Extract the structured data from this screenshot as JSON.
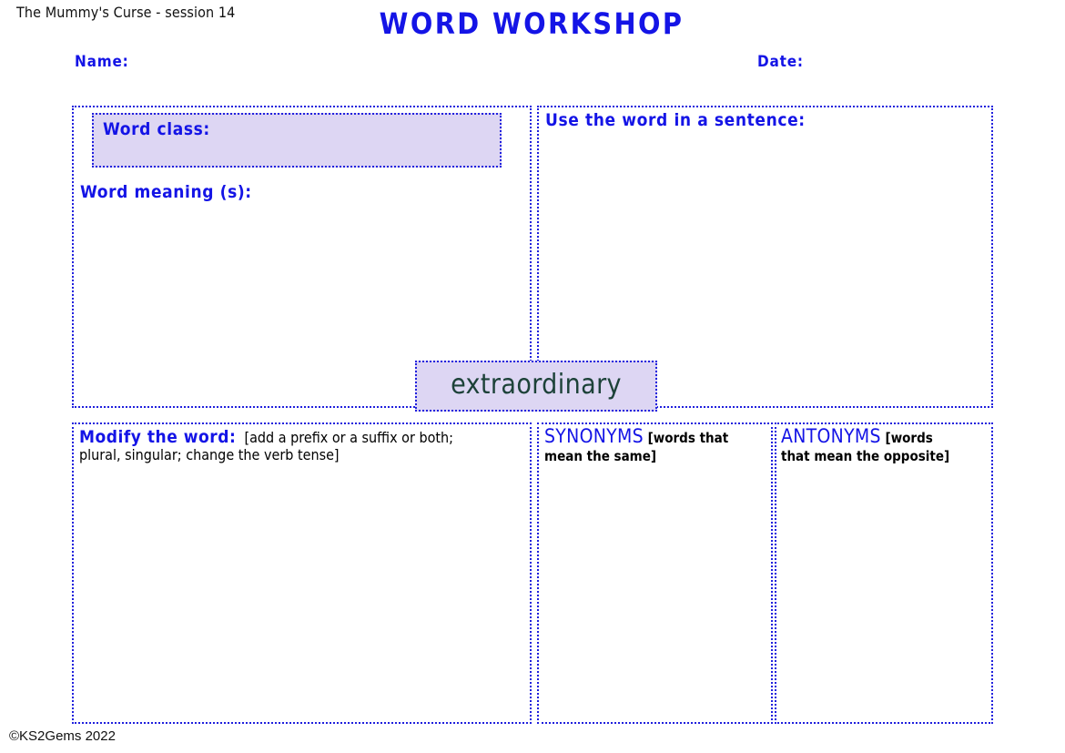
{
  "header": {
    "session_label": "The Mummy's Curse - session 14",
    "title": "WORD WORKSHOP",
    "name_label": "Name:",
    "date_label": "Date:"
  },
  "focus_word": "extraordinary",
  "panels": {
    "word_details": {
      "word_class_label": "Word class:",
      "word_meaning_label": "Word meaning (s):"
    },
    "sentence": {
      "label": "Use the word in a sentence:"
    },
    "modify": {
      "heading": "Modify the word:",
      "hint_line_1": "[add a prefix or a suffix or both;",
      "hint_line_2": "plural, singular; change the verb tense]"
    },
    "synonyms": {
      "heading": "SYNONYMS",
      "hint_line_1": "[words that",
      "hint_line_2": "mean the same]"
    },
    "antonyms": {
      "heading": "ANTONYMS",
      "hint_line_1": "[words",
      "hint_line_2": "that mean the opposite]"
    }
  },
  "footer": {
    "copyright": "©KS2Gems 2022"
  },
  "colors": {
    "accent_blue": "#1414e6",
    "border_blue": "#2020dd",
    "fill_lavender": "#ddd6f3",
    "focus_word_green": "#1d4239",
    "text_black": "#111111"
  }
}
